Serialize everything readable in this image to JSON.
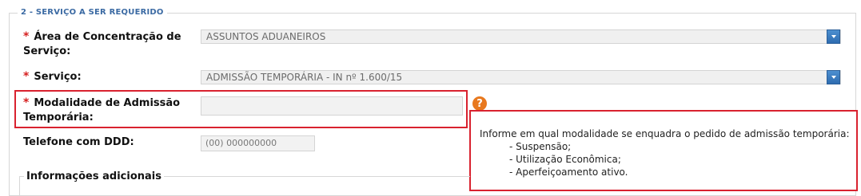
{
  "section": {
    "legend": "2 - SERVIÇO A SER REQUERIDO"
  },
  "fields": {
    "area": {
      "required": "*",
      "label_line1": "Área de Concentração de",
      "label_line2": "Serviço:",
      "value": "ASSUNTOS ADUANEIROS"
    },
    "servico": {
      "required": "*",
      "label": "Serviço:",
      "value": "ADMISSÃO TEMPORÁRIA - IN nº 1.600/15"
    },
    "modalidade": {
      "required": "*",
      "label_line1": "Modalidade de Admissão",
      "label_line2": "Temporária:",
      "value": ""
    },
    "telefone": {
      "label": "Telefone com DDD:",
      "value": "(00) 000000000"
    }
  },
  "help": {
    "icon": "question-icon",
    "glyph": "?",
    "tooltip": {
      "intro": "Informe em qual modalidade se enquadra o pedido de admissão temporária:",
      "items": [
        "- Suspensão;",
        "- Utilização Econômica;",
        "- Aperfeiçoamento ativo."
      ]
    }
  },
  "additional_info": {
    "legend": "Informações adicionais"
  },
  "colors": {
    "highlight": "#d9222f",
    "legend_blue": "#3b6aa3",
    "required_red": "#d62020",
    "help_orange": "#e8781e"
  }
}
